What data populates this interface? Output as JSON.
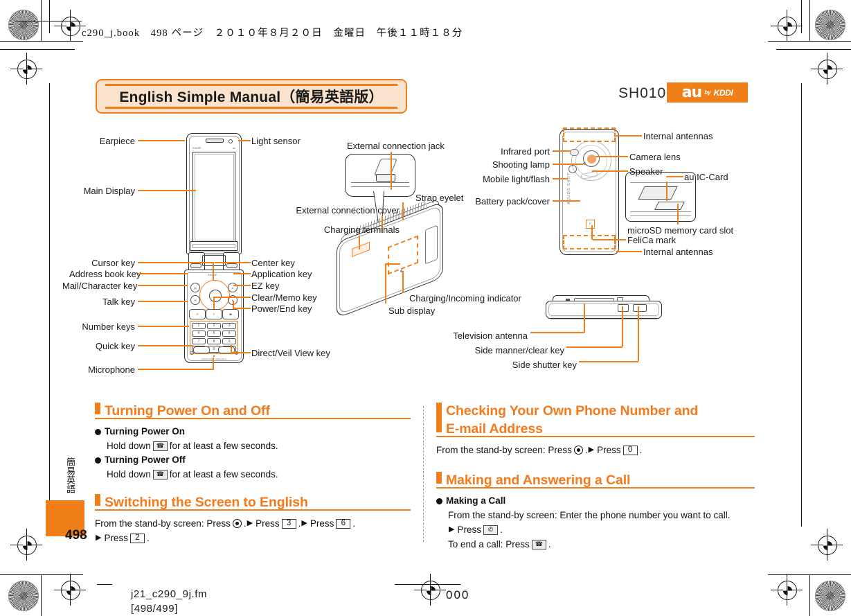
{
  "colors": {
    "accent": "#f07f1a",
    "heading": "#f47a1c",
    "text": "#111111",
    "title_fill": "#fbe2cc"
  },
  "print_header": "c290_j.book　498 ページ　２０１０年８月２０日　金曜日　午後１１時１８分",
  "footer": {
    "filename": "j21_c290_9j.fm",
    "pages": "[498/499]",
    "plate_number": "000"
  },
  "banner": {
    "title": "English Simple Manual（簡易英語版）"
  },
  "brand": {
    "model": "SH010",
    "logo_a": "au",
    "logo_by": "by",
    "logo_kddi": "KDDI"
  },
  "side": {
    "tab_text": "簡易英語",
    "page_number": "498"
  },
  "diagrams": {
    "front": {
      "name": "front-view",
      "labels": [
        {
          "id": "earpiece",
          "text": "Earpiece"
        },
        {
          "id": "light-sensor",
          "text": "Light sensor"
        },
        {
          "id": "main-display",
          "text": "Main Display"
        },
        {
          "id": "cursor-key",
          "text": "Cursor key"
        },
        {
          "id": "center-key",
          "text": "Center key"
        },
        {
          "id": "address-book-key",
          "text": "Address book key"
        },
        {
          "id": "application-key",
          "text": "Application key"
        },
        {
          "id": "mail-character-key",
          "text": "Mail/Character key"
        },
        {
          "id": "ez-key",
          "text": "EZ key"
        },
        {
          "id": "talk-key",
          "text": "Talk key"
        },
        {
          "id": "clear-memo-key",
          "text": "Clear/Memo key"
        },
        {
          "id": "power-end-key",
          "text": "Power/End key"
        },
        {
          "id": "number-keys",
          "text": "Number keys"
        },
        {
          "id": "quick-key",
          "text": "Quick key"
        },
        {
          "id": "direct-veil-view-key",
          "text": "Direct/Veil View key"
        },
        {
          "id": "microphone",
          "text": "Microphone"
        }
      ],
      "phone_marks": {
        "brand_left": "SHARP",
        "brand_right": "au",
        "sharp": "SHARP",
        "footnote": "AQUOS SHOT mobile phone"
      },
      "keypad": [
        "1",
        "2",
        "3",
        "4",
        "5",
        "6",
        "7",
        "8",
        "9",
        "✻",
        "0",
        "#"
      ],
      "soft_keys": [
        "TALK",
        "F/ZOOM",
        "POWER"
      ],
      "bottom_keys": [
        "クイック",
        "デジタル"
      ]
    },
    "closed": {
      "name": "closed-view",
      "labels": [
        {
          "id": "external-connection-jack",
          "text": "External connection jack"
        },
        {
          "id": "strap-eyelet",
          "text": "Strap eyelet"
        },
        {
          "id": "external-connection-cover",
          "text": "External connection cover"
        },
        {
          "id": "charging-terminals",
          "text": "Charging terminals"
        },
        {
          "id": "charging-incoming-indicator",
          "text": "Charging/Incoming indicator"
        },
        {
          "id": "sub-display",
          "text": "Sub display"
        }
      ]
    },
    "back": {
      "name": "back-view",
      "labels": [
        {
          "id": "internal-antennas-top",
          "text": "Internal antennas"
        },
        {
          "id": "infrared-port",
          "text": "Infrared port"
        },
        {
          "id": "camera-lens",
          "text": "Camera lens"
        },
        {
          "id": "shooting-lamp",
          "text": "Shooting lamp"
        },
        {
          "id": "speaker",
          "text": "Speaker"
        },
        {
          "id": "mobile-light-flash",
          "text": "Mobile light/flash"
        },
        {
          "id": "au-ic-card",
          "text": "au IC-Card"
        },
        {
          "id": "battery-pack-cover",
          "text": "Battery pack/cover"
        },
        {
          "id": "microsd-memory-card-slot",
          "text": "microSD memory card slot"
        },
        {
          "id": "felica-mark",
          "text": "FeliCa mark"
        },
        {
          "id": "internal-antennas-bottom",
          "text": "Internal antennas"
        }
      ],
      "phone_marks": {
        "aquos": "AQUOS SHOT",
        "felica": "f"
      }
    },
    "side": {
      "name": "side-view",
      "labels": [
        {
          "id": "television-antenna",
          "text": "Television antenna"
        },
        {
          "id": "side-manner-clear-key",
          "text": "Side manner/clear key"
        },
        {
          "id": "side-shutter-key",
          "text": "Side shutter key"
        }
      ]
    }
  },
  "sections": {
    "power": {
      "heading": "Turning Power On and Off",
      "on_label": "Turning Power On",
      "on_text_before": "Hold down",
      "on_text_after": "for at least a few seconds.",
      "on_key": "☎",
      "off_label": "Turning Power Off",
      "off_text_before": "Hold down",
      "off_text_after": "for at least a few seconds.",
      "off_key": "☎"
    },
    "switching": {
      "heading": "Switching the Screen to English",
      "line1_a": "From the stand-by screen: Press",
      "line1_b": ".",
      "line1_c": "Press",
      "line1_key1": "3",
      "line1_d": ".",
      "line1_e": "Press",
      "line1_key2": "6",
      "line1_f": ".",
      "line2_a": "Press",
      "line2_key": "2",
      "line2_b": "."
    },
    "checking": {
      "heading_line1": "Checking Your Own Phone Number and",
      "heading_line2": "E-mail Address",
      "line_a": "From the stand-by screen: Press",
      "line_b": ".",
      "line_c": "Press",
      "line_key": "0",
      "line_d": "."
    },
    "calling": {
      "heading": "Making and Answering a Call",
      "making_label": "Making a Call",
      "making_text": "From the stand-by screen: Enter the phone number you want to call.",
      "press_label": "Press",
      "press_key": "✆",
      "press_after": ".",
      "end_before": "To end a call: Press",
      "end_key": "☎",
      "end_after": "."
    }
  }
}
